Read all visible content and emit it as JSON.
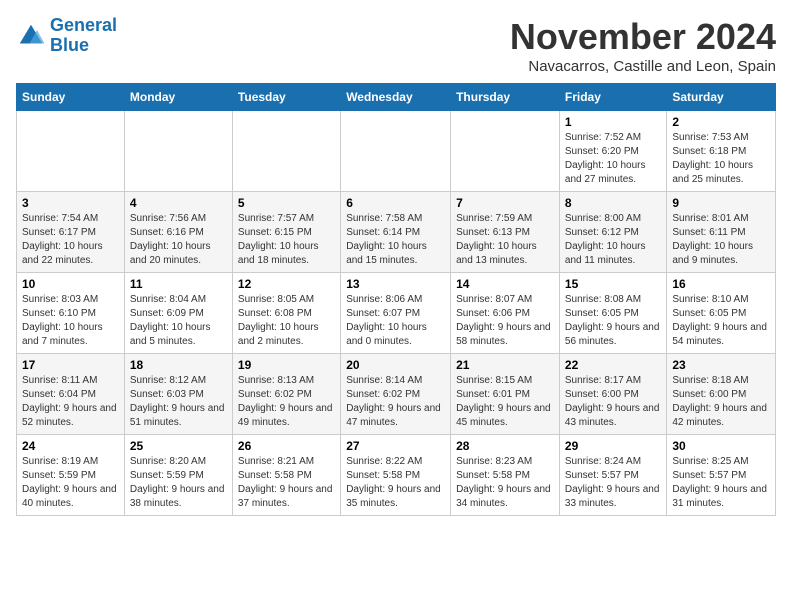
{
  "header": {
    "logo_line1": "General",
    "logo_line2": "Blue",
    "month": "November 2024",
    "location": "Navacarros, Castille and Leon, Spain"
  },
  "weekdays": [
    "Sunday",
    "Monday",
    "Tuesday",
    "Wednesday",
    "Thursday",
    "Friday",
    "Saturday"
  ],
  "weeks": [
    [
      {
        "day": "",
        "sunrise": "",
        "sunset": "",
        "daylight": ""
      },
      {
        "day": "",
        "sunrise": "",
        "sunset": "",
        "daylight": ""
      },
      {
        "day": "",
        "sunrise": "",
        "sunset": "",
        "daylight": ""
      },
      {
        "day": "",
        "sunrise": "",
        "sunset": "",
        "daylight": ""
      },
      {
        "day": "",
        "sunrise": "",
        "sunset": "",
        "daylight": ""
      },
      {
        "day": "1",
        "sunrise": "Sunrise: 7:52 AM",
        "sunset": "Sunset: 6:20 PM",
        "daylight": "Daylight: 10 hours and 27 minutes."
      },
      {
        "day": "2",
        "sunrise": "Sunrise: 7:53 AM",
        "sunset": "Sunset: 6:18 PM",
        "daylight": "Daylight: 10 hours and 25 minutes."
      }
    ],
    [
      {
        "day": "3",
        "sunrise": "Sunrise: 7:54 AM",
        "sunset": "Sunset: 6:17 PM",
        "daylight": "Daylight: 10 hours and 22 minutes."
      },
      {
        "day": "4",
        "sunrise": "Sunrise: 7:56 AM",
        "sunset": "Sunset: 6:16 PM",
        "daylight": "Daylight: 10 hours and 20 minutes."
      },
      {
        "day": "5",
        "sunrise": "Sunrise: 7:57 AM",
        "sunset": "Sunset: 6:15 PM",
        "daylight": "Daylight: 10 hours and 18 minutes."
      },
      {
        "day": "6",
        "sunrise": "Sunrise: 7:58 AM",
        "sunset": "Sunset: 6:14 PM",
        "daylight": "Daylight: 10 hours and 15 minutes."
      },
      {
        "day": "7",
        "sunrise": "Sunrise: 7:59 AM",
        "sunset": "Sunset: 6:13 PM",
        "daylight": "Daylight: 10 hours and 13 minutes."
      },
      {
        "day": "8",
        "sunrise": "Sunrise: 8:00 AM",
        "sunset": "Sunset: 6:12 PM",
        "daylight": "Daylight: 10 hours and 11 minutes."
      },
      {
        "day": "9",
        "sunrise": "Sunrise: 8:01 AM",
        "sunset": "Sunset: 6:11 PM",
        "daylight": "Daylight: 10 hours and 9 minutes."
      }
    ],
    [
      {
        "day": "10",
        "sunrise": "Sunrise: 8:03 AM",
        "sunset": "Sunset: 6:10 PM",
        "daylight": "Daylight: 10 hours and 7 minutes."
      },
      {
        "day": "11",
        "sunrise": "Sunrise: 8:04 AM",
        "sunset": "Sunset: 6:09 PM",
        "daylight": "Daylight: 10 hours and 5 minutes."
      },
      {
        "day": "12",
        "sunrise": "Sunrise: 8:05 AM",
        "sunset": "Sunset: 6:08 PM",
        "daylight": "Daylight: 10 hours and 2 minutes."
      },
      {
        "day": "13",
        "sunrise": "Sunrise: 8:06 AM",
        "sunset": "Sunset: 6:07 PM",
        "daylight": "Daylight: 10 hours and 0 minutes."
      },
      {
        "day": "14",
        "sunrise": "Sunrise: 8:07 AM",
        "sunset": "Sunset: 6:06 PM",
        "daylight": "Daylight: 9 hours and 58 minutes."
      },
      {
        "day": "15",
        "sunrise": "Sunrise: 8:08 AM",
        "sunset": "Sunset: 6:05 PM",
        "daylight": "Daylight: 9 hours and 56 minutes."
      },
      {
        "day": "16",
        "sunrise": "Sunrise: 8:10 AM",
        "sunset": "Sunset: 6:05 PM",
        "daylight": "Daylight: 9 hours and 54 minutes."
      }
    ],
    [
      {
        "day": "17",
        "sunrise": "Sunrise: 8:11 AM",
        "sunset": "Sunset: 6:04 PM",
        "daylight": "Daylight: 9 hours and 52 minutes."
      },
      {
        "day": "18",
        "sunrise": "Sunrise: 8:12 AM",
        "sunset": "Sunset: 6:03 PM",
        "daylight": "Daylight: 9 hours and 51 minutes."
      },
      {
        "day": "19",
        "sunrise": "Sunrise: 8:13 AM",
        "sunset": "Sunset: 6:02 PM",
        "daylight": "Daylight: 9 hours and 49 minutes."
      },
      {
        "day": "20",
        "sunrise": "Sunrise: 8:14 AM",
        "sunset": "Sunset: 6:02 PM",
        "daylight": "Daylight: 9 hours and 47 minutes."
      },
      {
        "day": "21",
        "sunrise": "Sunrise: 8:15 AM",
        "sunset": "Sunset: 6:01 PM",
        "daylight": "Daylight: 9 hours and 45 minutes."
      },
      {
        "day": "22",
        "sunrise": "Sunrise: 8:17 AM",
        "sunset": "Sunset: 6:00 PM",
        "daylight": "Daylight: 9 hours and 43 minutes."
      },
      {
        "day": "23",
        "sunrise": "Sunrise: 8:18 AM",
        "sunset": "Sunset: 6:00 PM",
        "daylight": "Daylight: 9 hours and 42 minutes."
      }
    ],
    [
      {
        "day": "24",
        "sunrise": "Sunrise: 8:19 AM",
        "sunset": "Sunset: 5:59 PM",
        "daylight": "Daylight: 9 hours and 40 minutes."
      },
      {
        "day": "25",
        "sunrise": "Sunrise: 8:20 AM",
        "sunset": "Sunset: 5:59 PM",
        "daylight": "Daylight: 9 hours and 38 minutes."
      },
      {
        "day": "26",
        "sunrise": "Sunrise: 8:21 AM",
        "sunset": "Sunset: 5:58 PM",
        "daylight": "Daylight: 9 hours and 37 minutes."
      },
      {
        "day": "27",
        "sunrise": "Sunrise: 8:22 AM",
        "sunset": "Sunset: 5:58 PM",
        "daylight": "Daylight: 9 hours and 35 minutes."
      },
      {
        "day": "28",
        "sunrise": "Sunrise: 8:23 AM",
        "sunset": "Sunset: 5:58 PM",
        "daylight": "Daylight: 9 hours and 34 minutes."
      },
      {
        "day": "29",
        "sunrise": "Sunrise: 8:24 AM",
        "sunset": "Sunset: 5:57 PM",
        "daylight": "Daylight: 9 hours and 33 minutes."
      },
      {
        "day": "30",
        "sunrise": "Sunrise: 8:25 AM",
        "sunset": "Sunset: 5:57 PM",
        "daylight": "Daylight: 9 hours and 31 minutes."
      }
    ]
  ]
}
